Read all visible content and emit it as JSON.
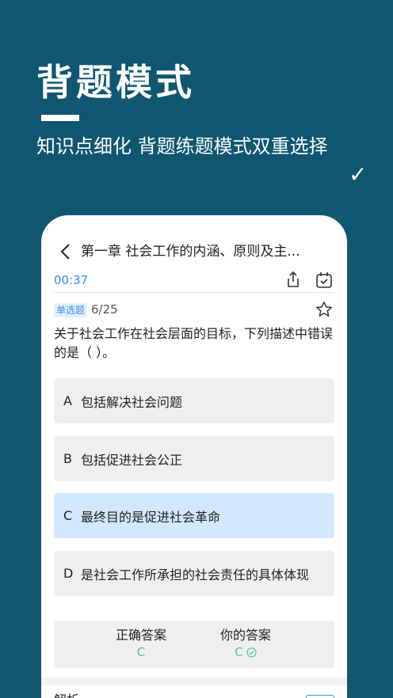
{
  "promo": {
    "title": "背题模式",
    "subtitle": "知识点细化  背题练题模式双重选择",
    "check": "✓"
  },
  "nav": {
    "back_icon": "chevron-left-icon",
    "title": "第一章  社会工作的内涵、原则及主..."
  },
  "toolbar": {
    "timer": "00:37",
    "share_icon": "share-icon",
    "calendar_icon": "calendar-check-icon"
  },
  "question": {
    "type": "单选题",
    "progress": "6/25",
    "star_icon": "star-icon",
    "text": "关于社会工作在社会层面的目标，下列描述中错误的是（   ）。"
  },
  "options": [
    {
      "letter": "A",
      "text": "包括解决社会问题"
    },
    {
      "letter": "B",
      "text": "包括促进社会公正"
    },
    {
      "letter": "C",
      "text": "最终目的是促进社会革命"
    },
    {
      "letter": "D",
      "text": "是社会工作所承担的社会责任的具体体现"
    }
  ],
  "selected_option": "C",
  "answers": {
    "correct_label": "正确答案",
    "correct_value": "C",
    "yours_label": "你的答案",
    "yours_value": "C",
    "status_icon": "check-circle-icon"
  },
  "analysis": {
    "label": "解析"
  },
  "colors": {
    "background": "#0f5671",
    "accent": "#3a8ee6",
    "correct": "#4fc3a1",
    "selected_option_bg": "#d3e8fe"
  }
}
